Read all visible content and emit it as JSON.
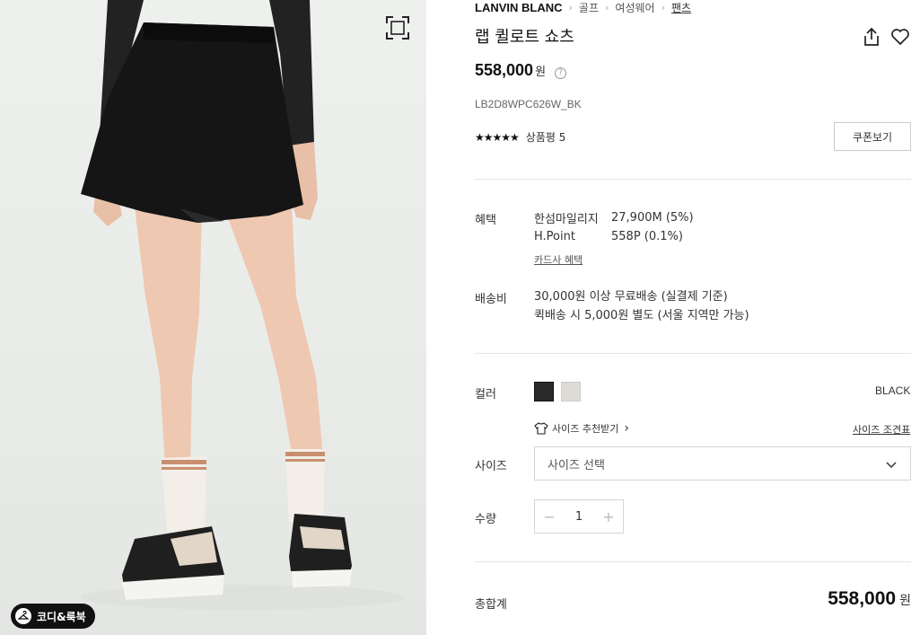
{
  "breadcrumb": {
    "brand": "LANVIN BLANC",
    "items": [
      "골프",
      "여성웨어",
      "팬츠"
    ]
  },
  "product": {
    "title": "랩 퀼로트 쇼츠",
    "price": "558,000",
    "currency": "원",
    "code": "LB2D8WPC626W_BK",
    "rating_stars": "★★★★★",
    "review_label": "상품평 5",
    "coupon_label": "쿠폰보기"
  },
  "benefits": {
    "label": "혜택",
    "rows": [
      {
        "name": "한섬마일리지",
        "value": "27,900M (5%)"
      },
      {
        "name": "H.Point",
        "value": "558P (0.1%)"
      }
    ],
    "card_link": "카드사 혜택"
  },
  "shipping": {
    "label": "배송비",
    "line1": "30,000원 이상 무료배송 (실결제 기준)",
    "line2": "퀵배송 시 5,000원 별도 (서울 지역만 가능)"
  },
  "color": {
    "label": "컬러",
    "selected": "BLACK",
    "swatches": [
      "#2a2a2a",
      "#dcdbd6"
    ]
  },
  "size": {
    "recommend_label": "사이즈 추천받기",
    "chart_label": "사이즈 조견표",
    "label": "사이즈",
    "placeholder": "사이즈 선택"
  },
  "quantity": {
    "label": "수량",
    "value": "1"
  },
  "total": {
    "label": "총합계",
    "amount": "558,000",
    "currency": "원"
  },
  "image": {
    "coordi_label": "코디&룩북"
  }
}
